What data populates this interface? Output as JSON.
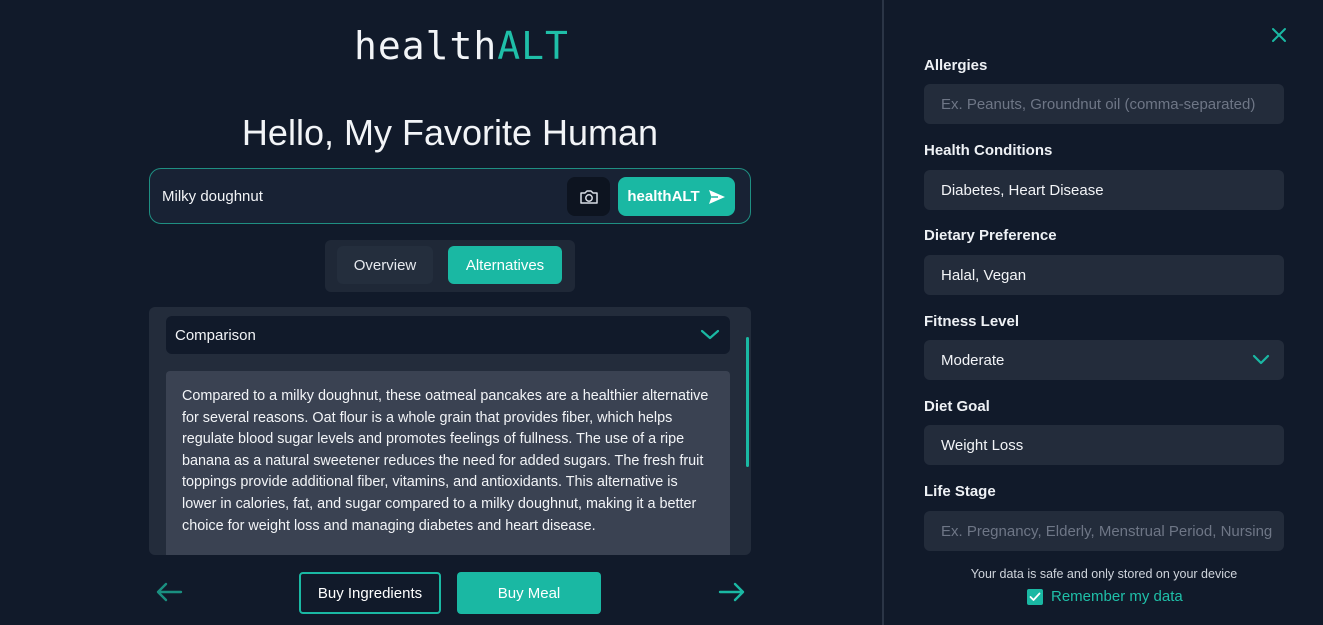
{
  "brand": {
    "part1": "health",
    "part2": "ALT"
  },
  "greeting": "Hello, My Favorite Human",
  "search": {
    "value": "Milky doughnut",
    "submit_label": "healthALT"
  },
  "tabs": [
    {
      "label": "Overview",
      "active": false
    },
    {
      "label": "Alternatives",
      "active": true
    }
  ],
  "comparison": {
    "title": "Comparison",
    "text": "Compared to a milky doughnut, these oatmeal pancakes are a healthier alternative for several reasons. Oat flour is a whole grain that provides fiber, which helps regulate blood sugar levels and promotes feelings of fullness. The use of a ripe banana as a natural sweetener reduces the need for added sugars. The fresh fruit toppings provide additional fiber, vitamins, and antioxidants. This alternative is lower in calories, fat, and sugar compared to a milky doughnut, making it a better choice for weight loss and managing diabetes and heart disease."
  },
  "actions": {
    "buy_ingredients": "Buy Ingredients",
    "buy_meal": "Buy Meal"
  },
  "profile": {
    "allergies": {
      "label": "Allergies",
      "value": "",
      "placeholder": "Ex. Peanuts, Groundnut oil (comma-separated)"
    },
    "health_conditions": {
      "label": "Health Conditions",
      "value": "Diabetes, Heart Disease"
    },
    "dietary_preference": {
      "label": "Dietary Preference",
      "value": "Halal, Vegan"
    },
    "fitness_level": {
      "label": "Fitness Level",
      "value": "Moderate"
    },
    "diet_goal": {
      "label": "Diet Goal",
      "value": "Weight Loss"
    },
    "life_stage": {
      "label": "Life Stage",
      "value": "",
      "placeholder": "Ex. Pregnancy, Elderly, Menstrual Period, Nursing"
    },
    "safe_note": "Your data is safe and only stored on your device",
    "remember_label": "Remember my data",
    "remember_checked": true
  },
  "colors": {
    "accent": "#1ab8a3",
    "background": "#111a2a",
    "surface": "#232c3b"
  },
  "icons": {
    "camera": "camera-icon",
    "send": "send-icon",
    "chevron": "chevron-down-icon",
    "prev": "arrow-left-icon",
    "next": "arrow-right-icon",
    "close": "close-icon",
    "check": "check-icon"
  }
}
